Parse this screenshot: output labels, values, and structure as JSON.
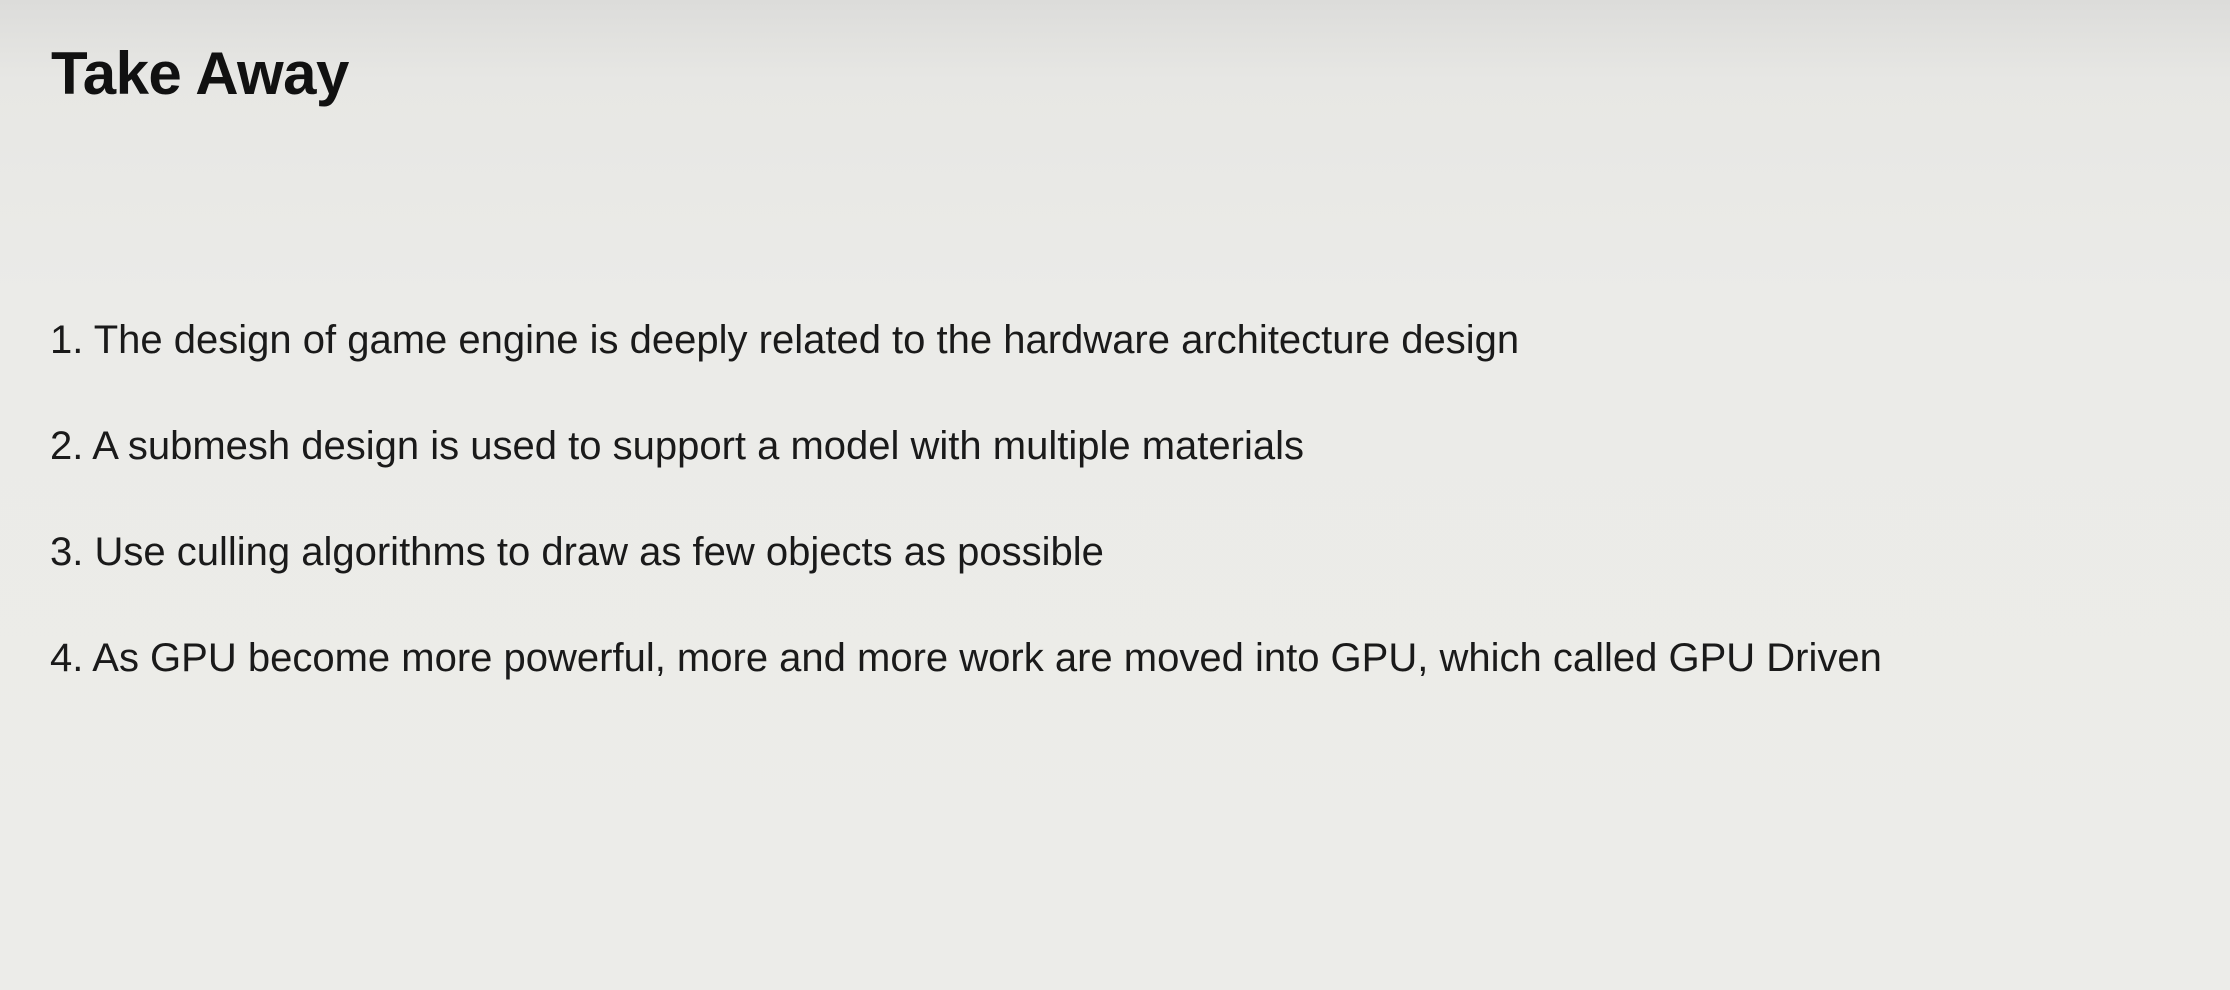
{
  "slide": {
    "title": "Take Away",
    "items": [
      "1. The design of game engine is deeply related to the hardware architecture design",
      "2. A submesh design is used to support a model with multiple materials",
      "3. Use culling algorithms to draw as few objects as possible",
      "4. As GPU become more powerful, more and more work are moved into GPU, which called GPU Driven"
    ]
  },
  "colors": {
    "background": "#ebebe8",
    "text": "#111111"
  }
}
